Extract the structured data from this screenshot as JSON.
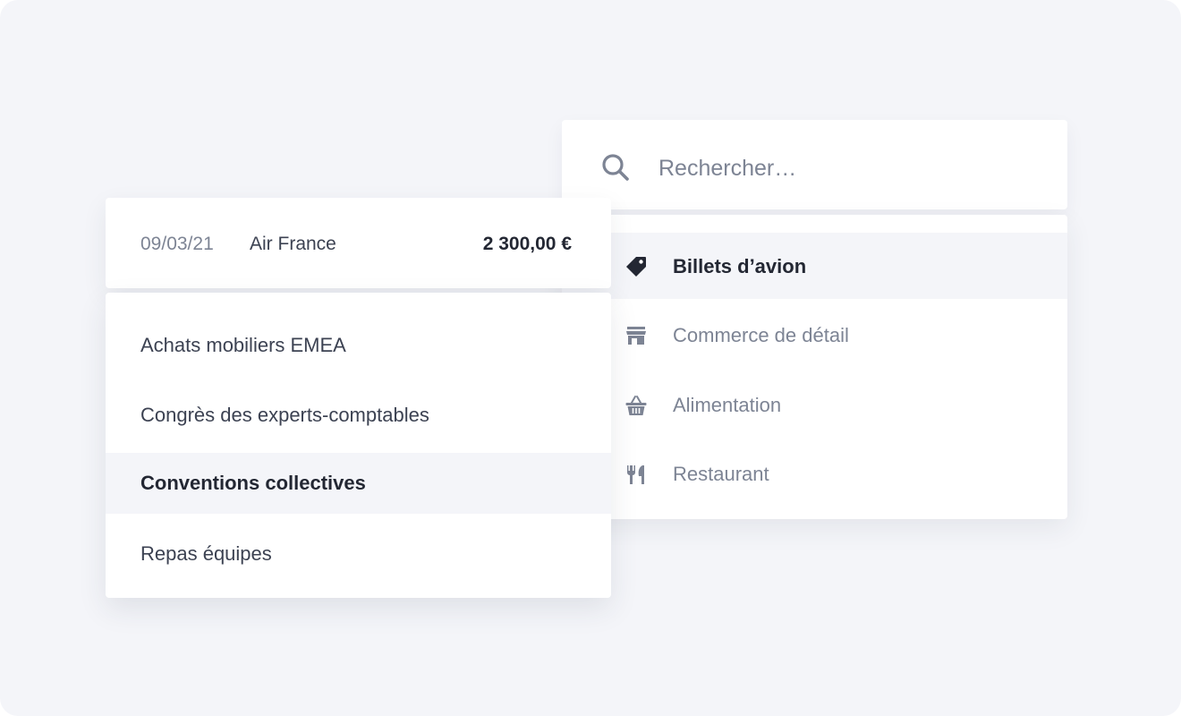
{
  "search": {
    "placeholder": "Rechercher…",
    "value": ""
  },
  "categories": [
    {
      "label": "Billets d’avion",
      "icon": "tag-icon",
      "selected": true
    },
    {
      "label": "Commerce de détail",
      "icon": "store-icon",
      "selected": false
    },
    {
      "label": "Alimentation",
      "icon": "basket-icon",
      "selected": false
    },
    {
      "label": "Restaurant",
      "icon": "fork-knife-icon",
      "selected": false
    }
  ],
  "transaction": {
    "date": "09/03/21",
    "merchant": "Air France",
    "amount": "2 300,00 €"
  },
  "projects": [
    {
      "label": "Achats mobiliers EMEA",
      "selected": false
    },
    {
      "label": "Congrès des experts-comptables",
      "selected": false
    },
    {
      "label": "Conventions collectives",
      "selected": true
    },
    {
      "label": "Repas équipes",
      "selected": false
    }
  ],
  "colors": {
    "background": "#f4f5f9",
    "card": "#ffffff",
    "text_strong": "#232733",
    "text_muted": "#7d8494",
    "highlight_row": "#f4f5f9"
  }
}
